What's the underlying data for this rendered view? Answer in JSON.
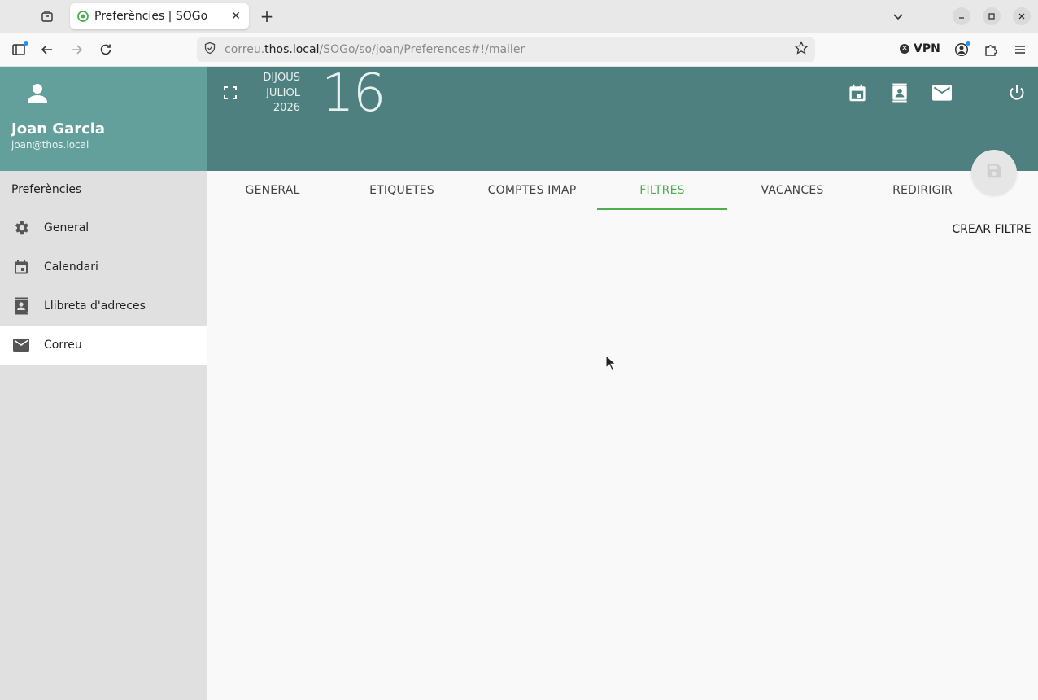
{
  "browser": {
    "tab_title": "Preferències | SOGo",
    "url_host_prefix": "correu.",
    "url_host": "thos.local",
    "url_path": "/SOGo/so/joan/Preferences#!/mailer",
    "vpn_label": "VPN"
  },
  "app": {
    "user": {
      "name": "Joan Garcia",
      "email": "joan@thos.local"
    },
    "sidebar": {
      "heading": "Preferències",
      "items": [
        {
          "label": "General",
          "icon": "gear-icon",
          "active": false
        },
        {
          "label": "Calendari",
          "icon": "calendar-icon",
          "active": false
        },
        {
          "label": "Llibreta d'adreces",
          "icon": "contacts-icon",
          "active": false
        },
        {
          "label": "Correu",
          "icon": "mail-icon",
          "active": true
        }
      ]
    },
    "header": {
      "weekday": "DIJOUS",
      "month": "JULIOL",
      "year": "2026",
      "day": "16"
    },
    "tabs": [
      {
        "label": "GENERAL",
        "active": false
      },
      {
        "label": "ETIQUETES",
        "active": false
      },
      {
        "label": "COMPTES IMAP",
        "active": false
      },
      {
        "label": "FILTRES",
        "active": true
      },
      {
        "label": "VACANCES",
        "active": false
      },
      {
        "label": "REDIRIGIR",
        "active": false
      }
    ],
    "create_filter_label": "CREAR FILTRE",
    "colors": {
      "user_card": "#64a09b",
      "header": "#4e8080",
      "accent": "#4caf50"
    }
  }
}
